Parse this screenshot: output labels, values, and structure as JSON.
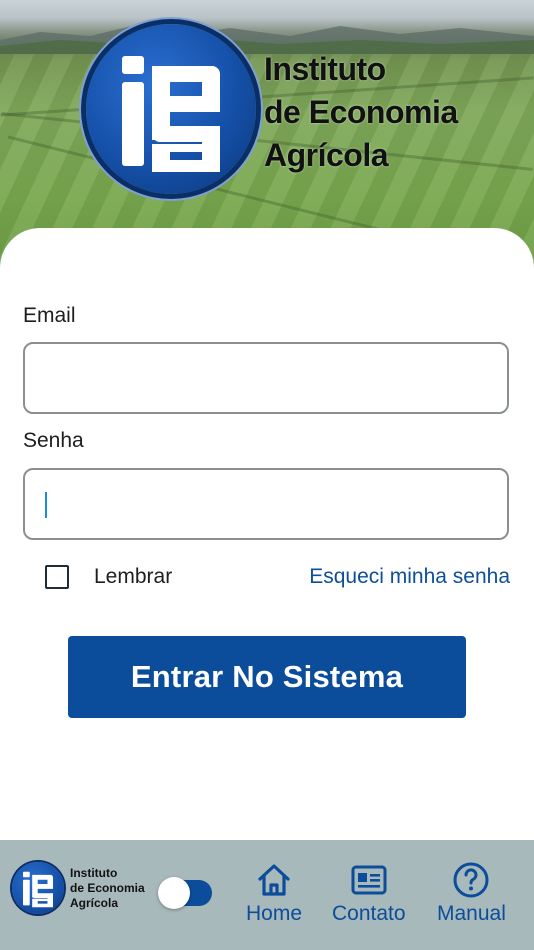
{
  "header": {
    "logo_letters": "iea",
    "logo_lines": [
      "Instituto",
      "de Economia",
      "Agrícola"
    ]
  },
  "form": {
    "email_label": "Email",
    "email_value": "",
    "password_label": "Senha",
    "password_value": "",
    "remember_label": "Lembrar",
    "remember_checked": false,
    "forgot_label": "Esqueci minha senha",
    "submit_label": "Entrar No Sistema"
  },
  "bottom_bar": {
    "logo_lines": [
      "Instituto",
      "de Economia",
      "Agrícola"
    ],
    "toggle_on": true,
    "nav": [
      {
        "label": "Home",
        "icon": "home-icon"
      },
      {
        "label": "Contato",
        "icon": "contact-card-icon"
      },
      {
        "label": "Manual",
        "icon": "help-circle-icon"
      }
    ]
  },
  "colors": {
    "primary": "#0b4d9a",
    "bottom_bar": "#a8b9bc",
    "caret": "#1e88e5"
  }
}
